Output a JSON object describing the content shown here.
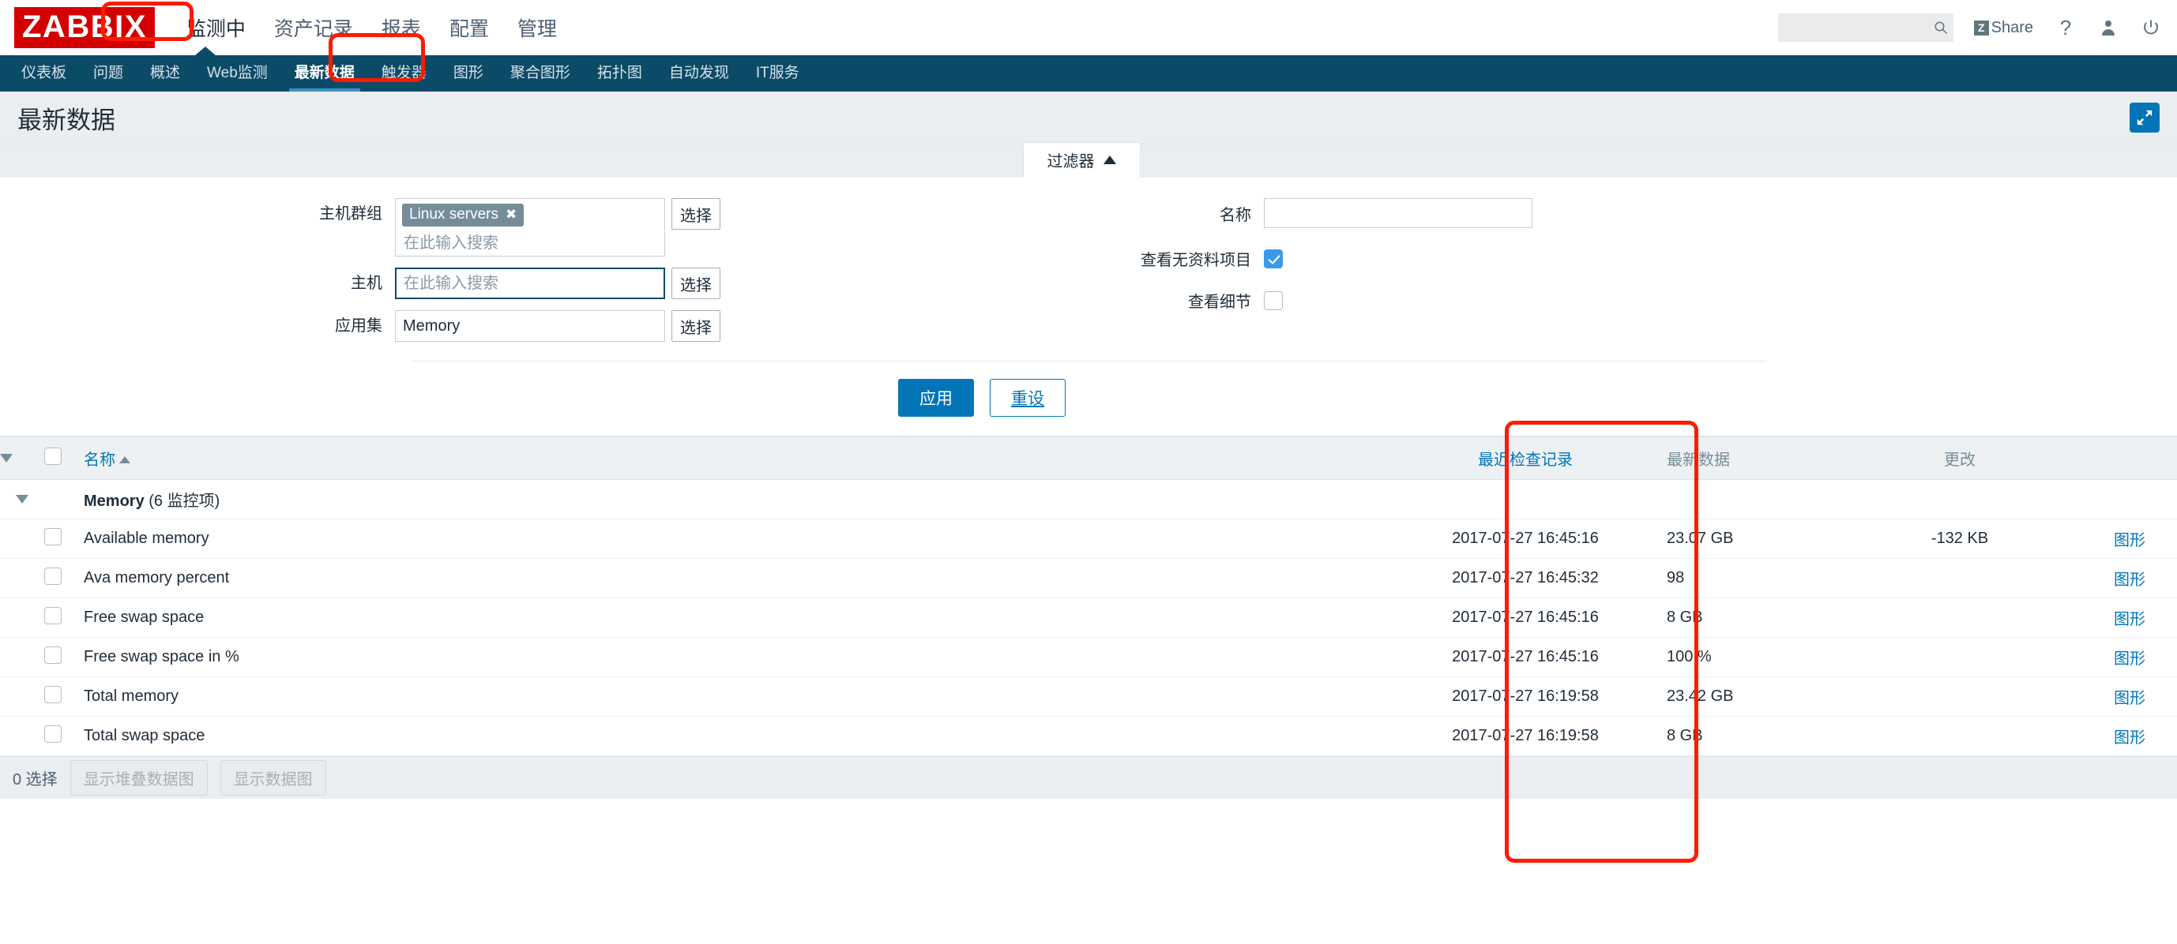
{
  "brand": {
    "logo_text": "ZABBIX",
    "logo_bg": "#d40000"
  },
  "header": {
    "nav": [
      {
        "label": "监测中",
        "active": true
      },
      {
        "label": "资产记录",
        "active": false
      },
      {
        "label": "报表",
        "active": false
      },
      {
        "label": "配置",
        "active": false
      },
      {
        "label": "管理",
        "active": false
      }
    ],
    "search": {
      "value": "",
      "placeholder": ""
    },
    "share_label": "Share",
    "share_badge": "Z",
    "help_label": "?"
  },
  "subnav": {
    "items": [
      {
        "label": "仪表板",
        "active": false
      },
      {
        "label": "问题",
        "active": false
      },
      {
        "label": "概述",
        "active": false
      },
      {
        "label": "Web监测",
        "active": false
      },
      {
        "label": "最新数据",
        "active": true
      },
      {
        "label": "触发器",
        "active": false
      },
      {
        "label": "图形",
        "active": false
      },
      {
        "label": "聚合图形",
        "active": false
      },
      {
        "label": "拓扑图",
        "active": false
      },
      {
        "label": "自动发现",
        "active": false
      },
      {
        "label": "IT服务",
        "active": false
      }
    ]
  },
  "page": {
    "title": "最新数据"
  },
  "filter": {
    "tab_label": "过滤器",
    "host_group": {
      "label": "主机群组",
      "chip": "Linux servers",
      "chip_remove": "✖",
      "placeholder": "在此输入搜索",
      "select_button": "选择"
    },
    "host": {
      "label": "主机",
      "value": "",
      "placeholder": "在此输入搜索",
      "select_button": "选择"
    },
    "application": {
      "label": "应用集",
      "value": "Memory",
      "placeholder": "",
      "select_button": "选择"
    },
    "name": {
      "label": "名称",
      "value": "",
      "placeholder": ""
    },
    "show_items_without_data": {
      "label": "查看无资料项目",
      "checked": true
    },
    "show_details": {
      "label": "查看细节",
      "checked": false
    },
    "apply_button": "应用",
    "reset_button": "重设"
  },
  "table": {
    "columns": {
      "name": "名称",
      "last_check": "最近检查记录",
      "last_value": "最新数据",
      "change": "更改"
    },
    "group": {
      "name": "Memory",
      "count_label": "(6 监控项)"
    },
    "rows": [
      {
        "name": "Available memory",
        "last_check": "2017-07-27 16:45:16",
        "last_value": "23.07 GB",
        "change": "-132 KB",
        "graph": "图形"
      },
      {
        "name": "Ava memory percent",
        "last_check": "2017-07-27 16:45:32",
        "last_value": "98",
        "change": "",
        "graph": "图形"
      },
      {
        "name": "Free swap space",
        "last_check": "2017-07-27 16:45:16",
        "last_value": "8 GB",
        "change": "",
        "graph": "图形"
      },
      {
        "name": "Free swap space in %",
        "last_check": "2017-07-27 16:45:16",
        "last_value": "100 %",
        "change": "",
        "graph": "图形"
      },
      {
        "name": "Total memory",
        "last_check": "2017-07-27 16:19:58",
        "last_value": "23.42 GB",
        "change": "",
        "graph": "图形"
      },
      {
        "name": "Total swap space",
        "last_check": "2017-07-27 16:19:58",
        "last_value": "8 GB",
        "change": "",
        "graph": "图形"
      }
    ]
  },
  "footer": {
    "selected_label": "0 选择",
    "stacked_graph_button": "显示堆叠数据图",
    "graph_button": "显示数据图"
  },
  "colors": {
    "brand_red": "#d40000",
    "nav_blue": "#0c4b68",
    "accent_blue": "#0275b8",
    "highlight_red": "#ff1a00"
  }
}
